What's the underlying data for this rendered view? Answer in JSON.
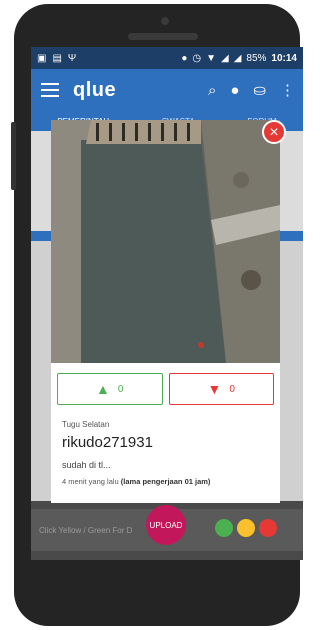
{
  "statusbar": {
    "battery": "85%",
    "time": "10:14"
  },
  "appbar": {
    "logo": "qlue"
  },
  "tabs": [
    "PEMERINTAH",
    "SWASTA",
    "FORUM"
  ],
  "report": {
    "location": "Tugu Selatan",
    "username": "rikudo271931",
    "description": "sudah di tl...",
    "time_ago": "4 menit yang lalu",
    "duration": "(lama pengerjaan 01 jam)",
    "upvotes": "0",
    "downvotes": "0"
  },
  "bottom": {
    "hint": "Click Yellow / Green For D",
    "upload_label": "UPLOAD"
  },
  "colors": {
    "appbar": "#2e6fbe",
    "up": "#4caf50",
    "down": "#e53935",
    "upload": "#c2185b"
  }
}
